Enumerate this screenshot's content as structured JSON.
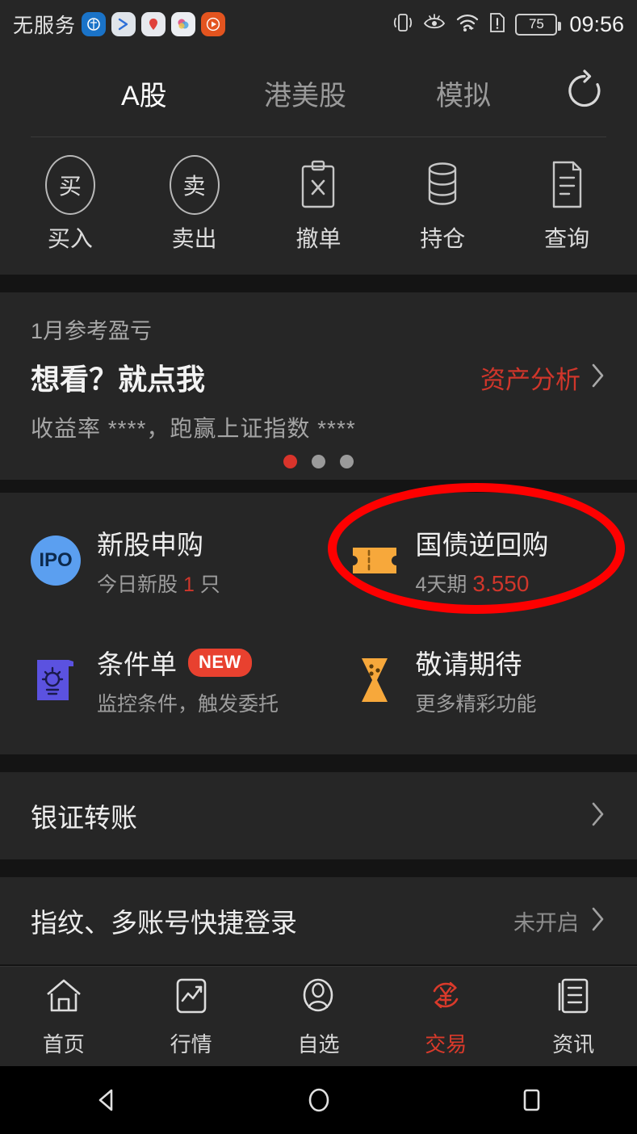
{
  "status_bar": {
    "carrier": "无服务",
    "app_icons": [
      "app-icon-blue",
      "app-icon-arrow",
      "app-icon-pin",
      "app-icon-color",
      "app-icon-play"
    ],
    "icons": [
      "vibrate-icon",
      "eye-comfort-icon",
      "wifi-icon",
      "sim-alert-icon"
    ],
    "battery_level": "75",
    "time": "09:56"
  },
  "top_tabs": {
    "items": [
      {
        "label": "A股",
        "active": true
      },
      {
        "label": "港美股",
        "active": false
      },
      {
        "label": "模拟",
        "active": false
      }
    ],
    "refresh_icon": "refresh-icon"
  },
  "actions": [
    {
      "label": "买入",
      "glyph": "买",
      "icon": "buy-circle-icon"
    },
    {
      "label": "卖出",
      "glyph": "卖",
      "icon": "sell-circle-icon"
    },
    {
      "label": "撤单",
      "icon": "cancel-order-clipboard-icon"
    },
    {
      "label": "持仓",
      "icon": "positions-stack-icon"
    },
    {
      "label": "查询",
      "icon": "query-document-icon"
    }
  ],
  "pnl_card": {
    "period_label": "1月参考盈亏",
    "title": "想看？就点我",
    "link_label": "资产分析",
    "description": "收益率 ****，跑赢上证指数 ****",
    "dots_total": 3,
    "dots_active_index": 0,
    "accent_color": "#d0362b"
  },
  "features": [
    {
      "title": "新股申购",
      "sub_prefix": "今日新股 ",
      "sub_highlight": "1",
      "sub_suffix": " 只",
      "icon": "ipo-icon",
      "icon_text": "IPO",
      "icon_color": "#5b9ff0"
    },
    {
      "title": "国债逆回购",
      "sub_prefix": "4天期 ",
      "sub_rate": "3.550",
      "icon": "bond-ticket-icon",
      "icon_color": "#f7a83b",
      "highlighted": true
    },
    {
      "title": "条件单",
      "badge": "NEW",
      "sub_prefix": "监控条件，触发委托",
      "icon": "conditional-order-bulb-icon",
      "icon_color": "#5b52e0"
    },
    {
      "title": "敬请期待",
      "sub_prefix": "更多精彩功能",
      "icon": "hourglass-icon",
      "icon_color": "#f7a83b"
    }
  ],
  "list_rows": [
    {
      "label": "银证转账",
      "value": "",
      "chevron": "chevron-right-icon"
    },
    {
      "label": "指纹、多账号快捷登录",
      "value": "未开启",
      "chevron": "chevron-right-icon"
    }
  ],
  "bottom_nav": [
    {
      "label": "首页",
      "icon": "home-icon",
      "active": false
    },
    {
      "label": "行情",
      "icon": "quotes-chart-icon",
      "active": false
    },
    {
      "label": "自选",
      "icon": "watchlist-person-icon",
      "active": false
    },
    {
      "label": "交易",
      "icon": "trade-yen-refresh-icon",
      "active": true
    },
    {
      "label": "资讯",
      "icon": "news-icon",
      "active": false
    }
  ],
  "android_nav": {
    "back": "back-triangle-icon",
    "home": "home-circle-icon",
    "recents": "recents-square-icon"
  },
  "annotation": {
    "shape": "ellipse",
    "color": "#fe0000",
    "targets": "国债逆回购"
  }
}
